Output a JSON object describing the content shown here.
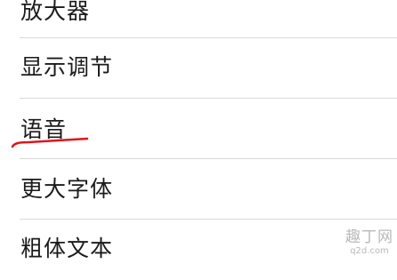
{
  "settings": {
    "items": [
      {
        "label": "放大器"
      },
      {
        "label": "显示调节"
      },
      {
        "label": "语音"
      },
      {
        "label": "更大字体"
      },
      {
        "label": "粗体文本"
      }
    ]
  },
  "annotation": {
    "underline_color": "#e0141e"
  },
  "watermark": {
    "main": "趣丁网",
    "sub": "q2d.com"
  }
}
